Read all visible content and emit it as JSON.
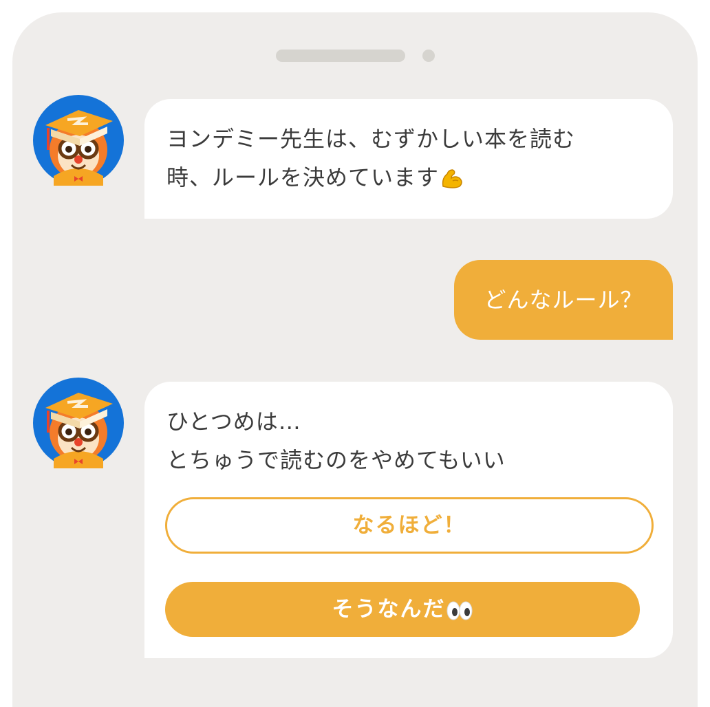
{
  "chat": {
    "messages": [
      {
        "sender": "teacher",
        "avatar_icon": "teacher-owl-graduation-cap-icon",
        "lines": [
          "ヨンデミー先生は、むずかしい本を読む",
          "時、ルールを決めています"
        ],
        "emoji_icon": "flexed-biceps-icon"
      },
      {
        "sender": "user",
        "text": "どんなルール？"
      },
      {
        "sender": "teacher",
        "avatar_icon": "teacher-owl-graduation-cap-icon",
        "lines": [
          "ひとつめは…",
          "とちゅうで読むのをやめてもいい"
        ]
      }
    ],
    "replies": {
      "option_1": "なるほど！",
      "option_2": "そうなんだ",
      "option_2_emoji_icon": "eyes-icon"
    }
  },
  "colors": {
    "accent": "#f0ae3a",
    "background": "#efedeb",
    "bubble": "#ffffff",
    "text": "#3b3b3b",
    "avatar_ring": "#1473d8"
  }
}
